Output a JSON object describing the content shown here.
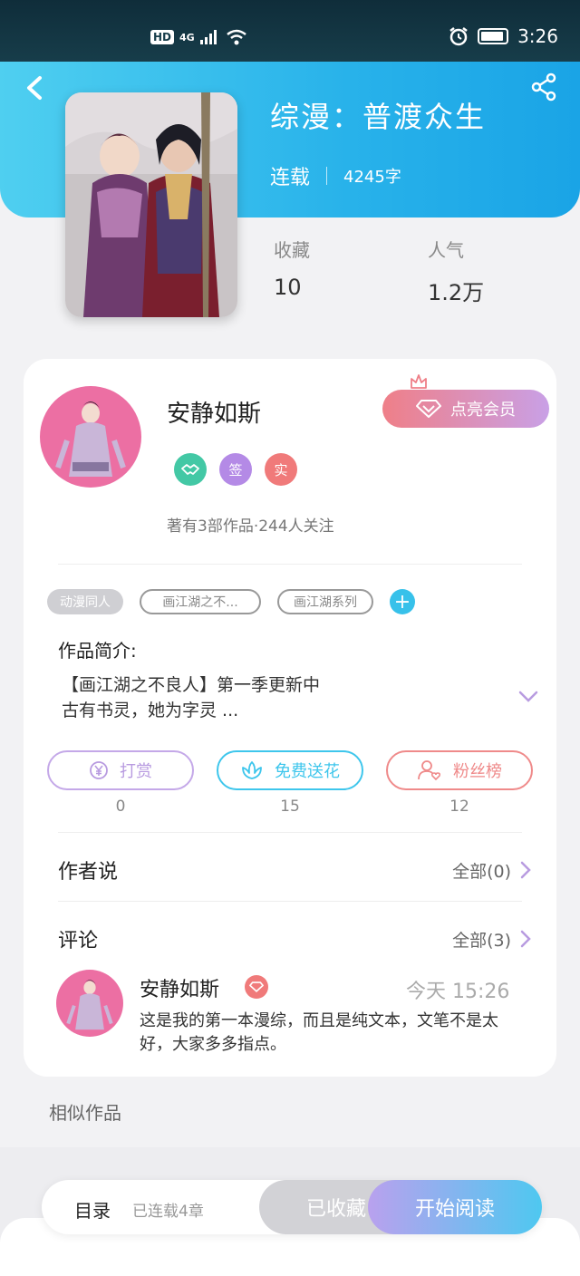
{
  "status": {
    "network": "4G",
    "time": "3:26",
    "hd": "HD"
  },
  "book": {
    "title": "综漫：普渡众生",
    "state": "连载",
    "words": "4245字",
    "stats": [
      {
        "label": "收藏",
        "value": "10"
      },
      {
        "label": "人气",
        "value": "1.2万"
      }
    ]
  },
  "author": {
    "name": "安静如斯",
    "vip_label": "点亮会员",
    "badges": [
      "签",
      "实"
    ],
    "info": "著有3部作品·244人关注"
  },
  "tags": [
    "动漫同人",
    "画江湖之不...",
    "画江湖系列"
  ],
  "intro": {
    "label": "作品简介:",
    "line1": "【画江湖之不良人】第一季更新中",
    "line2": "古有书灵，她为字灵  ..."
  },
  "actions": [
    {
      "label": "打赏",
      "count": "0",
      "color": "#b89be0"
    },
    {
      "label": "免费送花",
      "count": "15",
      "color": "#3ec6ec"
    },
    {
      "label": "粉丝榜",
      "count": "12",
      "color": "#ef8a8a"
    }
  ],
  "author_says": {
    "title": "作者说",
    "more": "全部(0)"
  },
  "comments": {
    "title": "评论",
    "more": "全部(3)",
    "first": {
      "name": "安静如斯",
      "time": "今天 15:26",
      "text": "这是我的第一本漫综，而且是纯文本，文笔不是太好，大家多多指点。"
    }
  },
  "similar": "相似作品",
  "footer": {
    "toc": "目录",
    "toc_sub": "已连载4章",
    "collected": "已收藏",
    "read": "开始阅读"
  }
}
